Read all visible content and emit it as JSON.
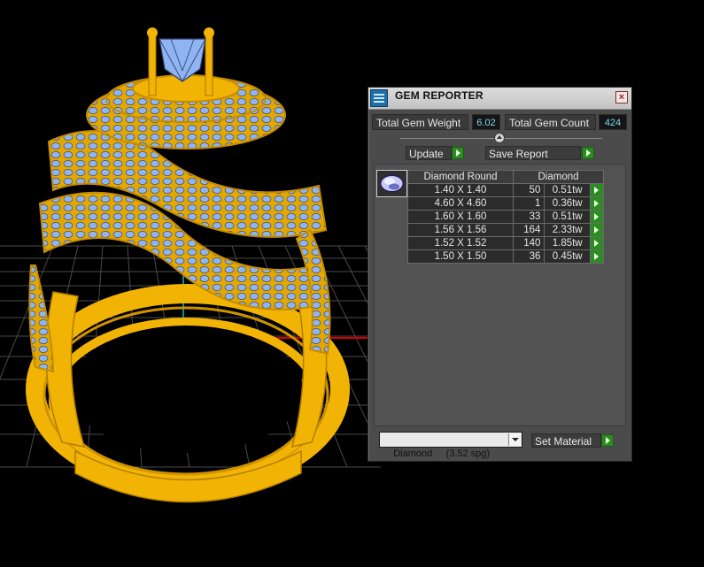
{
  "window": {
    "title": "GEM REPORTER",
    "icon": "gem-report-icon",
    "close_icon": "close-icon"
  },
  "summary": {
    "total_weight_label": "Total Gem Weight",
    "total_weight_value": "6.02",
    "total_count_label": "Total Gem Count",
    "total_count_value": "424"
  },
  "actions": {
    "update_label": "Update",
    "save_report_label": "Save Report",
    "set_material_label": "Set Material"
  },
  "table": {
    "header_shape": "Diamond Round",
    "header_material": "Diamond",
    "rows": [
      {
        "size": "1.40 X 1.40",
        "count": "50",
        "weight": "0.51tw"
      },
      {
        "size": "4.60 X 4.60",
        "count": "1",
        "weight": "0.36tw"
      },
      {
        "size": "1.60 X 1.60",
        "count": "33",
        "weight": "0.51tw"
      },
      {
        "size": "1.56 X 1.56",
        "count": "164",
        "weight": "2.33tw"
      },
      {
        "size": "1.52 X 1.52",
        "count": "140",
        "weight": "1.85tw"
      },
      {
        "size": "1.50 X 1.50",
        "count": "36",
        "weight": "0.45tw"
      }
    ]
  },
  "material": {
    "selected": "Diamond     (3.52 spg)"
  },
  "colors": {
    "metal": "#f2b404",
    "gem": "#8fb4f2",
    "grid": "#4a4a4a",
    "axis_red": "#d40000",
    "axis_teal": "#0a8c8c"
  }
}
